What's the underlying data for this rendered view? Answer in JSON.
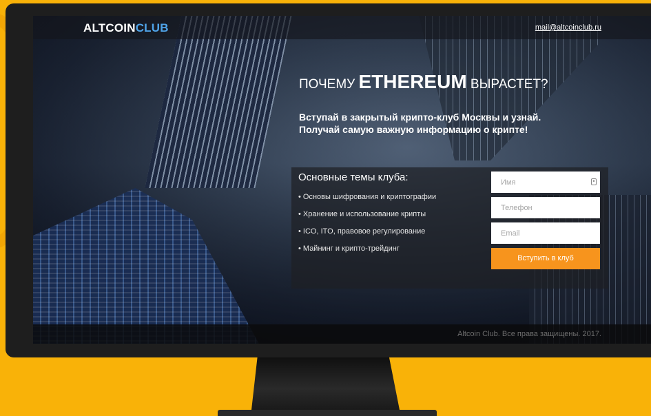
{
  "header": {
    "logo_main": "ALTCOIN",
    "logo_accent": "CLUB",
    "email": "mail@altcoinclub.ru"
  },
  "hero": {
    "headline_pre": "ПОЧЕМУ ",
    "headline_big": "ETHEREUM",
    "headline_post": " ВЫРАСТЕТ?",
    "sub_line1": "Вступай в закрытый крипто-клуб Москвы и узнай.",
    "sub_line2": "Получай самую важную информацию о крипте!"
  },
  "topics": {
    "title": "Основные темы клуба:",
    "items": [
      "• Основы шифрования и криптографии",
      "• Хранение и использование крипты",
      "• ICO, ITO, правовое регулирование",
      "• Майнинг и крипто-трейдинг"
    ]
  },
  "form": {
    "name_placeholder": "Имя",
    "phone_placeholder": "Телефон",
    "email_placeholder": "Email",
    "submit_label": "Вступить в клуб"
  },
  "footer": {
    "copyright": "Altcoin Club. Все права защищены. 2017."
  },
  "colors": {
    "background": "#f9b208",
    "accent_button": "#f7941d",
    "logo_accent": "#4fa3e8",
    "bezel": "#1e1e1e"
  },
  "icons": {
    "autofill": "contact-card-icon"
  }
}
